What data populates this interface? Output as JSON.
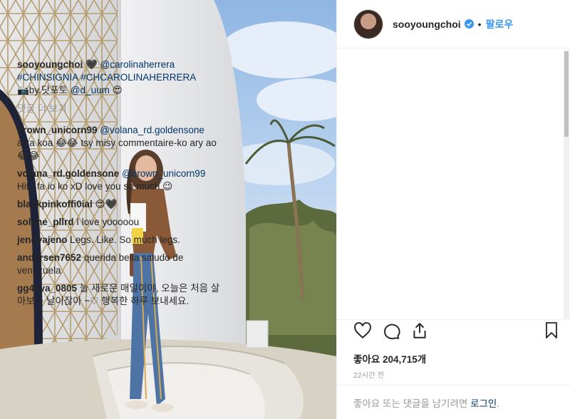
{
  "post": {
    "username": "sooyoungchoi",
    "follow_label": "팔로우",
    "dot": "•",
    "caption": {
      "username": "sooyoungchoi",
      "heart": "🖤",
      "mention": "@carolinaherrera",
      "hashtags": "#CHINSIGNIA #CHCAROLINAHERRERA",
      "credit_prefix": "📷by.닷포토",
      "credit_mention": "@d_uum",
      "credit_emoji": "😍"
    },
    "view_more_comments": "댓글 더 보기",
    "comments": [
      {
        "user": "brown_unicorn99",
        "mention": "@volana_rd.goldensone",
        "text": "aiza koa 😂😂 tsy misy commentaire-ko ary ao 😂😂"
      },
      {
        "user": "volana_rd.goldensone",
        "mention": "@brown_unicorn99",
        "text": "Hita fa io ko xD love you so much 😉"
      },
      {
        "user": "blackpinkoffi0ial",
        "mention": "",
        "text": "😍🖤"
      },
      {
        "user": "solene_pllrd",
        "mention": "",
        "text": "I love yooooou"
      },
      {
        "user": "jenoyajeno",
        "mention": "",
        "text": "Legs. Like. So much legs."
      },
      {
        "user": "andersen7652",
        "mention": "",
        "text": "querida bella saludo de venezuela"
      },
      {
        "user": "gg4eva_0805",
        "mention": "",
        "text": "늘 새로운 매일이야, 오늘은 처음 살아보는 날이잖아 ~♡ 행복한 하루 보내세요."
      }
    ],
    "likes_text": "좋아요 204,715개",
    "time_ago": "22시간 전",
    "login_prompt": "좋아요 또는 댓글을 남기려면",
    "login_link": "로그인",
    "login_suffix": "."
  },
  "icons": {
    "like": "heart-icon",
    "comment": "comment-icon",
    "share": "share-icon",
    "save": "bookmark-icon",
    "verified": "verified-badge-icon"
  },
  "colors": {
    "link": "#003569",
    "accent": "#3897f0",
    "muted": "#999999",
    "text": "#262626"
  }
}
